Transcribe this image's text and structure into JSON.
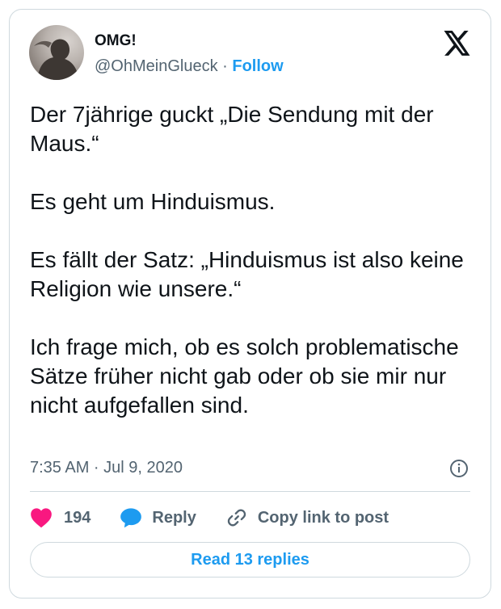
{
  "author": {
    "display_name": "OMG!",
    "handle": "@OhMeinGlueck",
    "separator": "·",
    "follow_label": "Follow",
    "avatar_icon": "avatar-photo"
  },
  "tweet": {
    "paragraphs": [
      "Der 7jährige guckt „Die Sendung mit der Maus.“",
      "Es geht um Hinduismus.",
      "Es fällt der Satz: „Hinduismus ist also keine Religion wie unsere.“",
      "Ich frage mich, ob es solch problematische Sätze früher nicht gab oder ob sie mir nur nicht aufgefallen sind."
    ],
    "timestamp": "7:35 AM · Jul 9, 2020"
  },
  "actions": {
    "like_count": "194",
    "reply_label": "Reply",
    "copy_link_label": "Copy link to post"
  },
  "footer": {
    "read_replies_label": "Read 13 replies"
  },
  "colors": {
    "accent": "#1d9bf0",
    "like": "#f91880",
    "muted": "#536471",
    "text": "#0f1419",
    "border": "#cfd9de"
  },
  "icons": [
    "x-logo-icon",
    "info-icon",
    "heart-icon",
    "reply-bubble-icon",
    "link-icon"
  ]
}
